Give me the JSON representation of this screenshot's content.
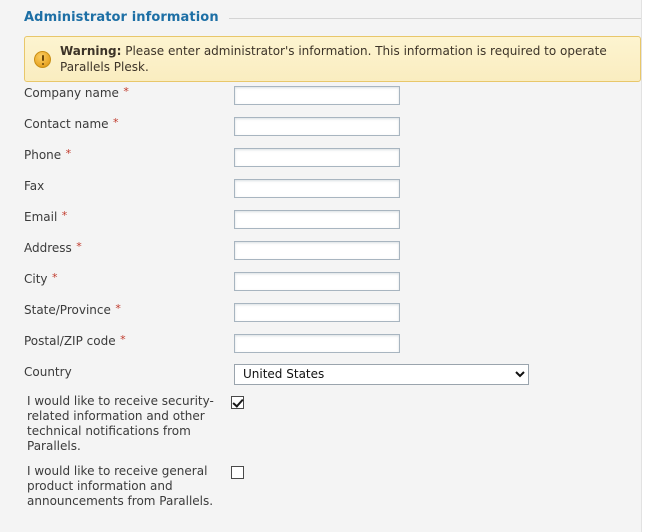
{
  "section": {
    "title": "Administrator information"
  },
  "warning": {
    "icon": "warning-exclamation-icon",
    "label": "Warning:",
    "message": " Please enter administrator's information. This information is required to operate Parallels Plesk.",
    "background_color": "#fbf0c8",
    "border_color": "#e8c76a",
    "icon_color": "#e8a525"
  },
  "required_marker": "*",
  "fields": [
    {
      "label": "Company name",
      "required": true,
      "value": "",
      "placeholder": "",
      "name": "company-name"
    },
    {
      "label": "Contact name",
      "required": true,
      "value": "",
      "placeholder": "",
      "name": "contact-name"
    },
    {
      "label": "Phone",
      "required": true,
      "value": "",
      "placeholder": "",
      "name": "phone"
    },
    {
      "label": "Fax",
      "required": false,
      "value": "",
      "placeholder": "",
      "name": "fax"
    },
    {
      "label": "Email",
      "required": true,
      "value": "",
      "placeholder": "",
      "name": "email"
    },
    {
      "label": "Address",
      "required": true,
      "value": "",
      "placeholder": "",
      "name": "address"
    },
    {
      "label": "City",
      "required": true,
      "value": "",
      "placeholder": "",
      "name": "city"
    },
    {
      "label": "State/Province",
      "required": true,
      "value": "",
      "placeholder": "",
      "name": "state-province"
    },
    {
      "label": "Postal/ZIP code",
      "required": true,
      "value": "",
      "placeholder": "",
      "name": "postal-zip-code"
    }
  ],
  "country": {
    "label": "Country",
    "required": false,
    "selected": "United States",
    "options": [
      "United States"
    ]
  },
  "checkboxes": [
    {
      "label": "I would like to receive security-related information and other technical notifications from Parallels.",
      "checked": true,
      "name": "security-notifications"
    },
    {
      "label": "I would like to receive general product information and announcements from Parallels.",
      "checked": false,
      "name": "product-announcements"
    }
  ],
  "theme": {
    "heading_color": "#1d6fa5",
    "background": "#f4f4f4",
    "label_color": "#3b3b3b",
    "required_color": "#c0392b",
    "input_border": "#a8b5c0"
  }
}
